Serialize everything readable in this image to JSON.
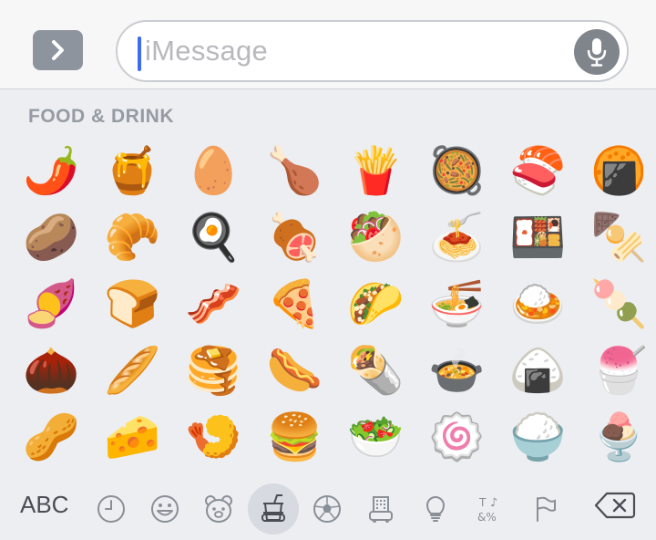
{
  "input": {
    "placeholder": "iMessage"
  },
  "keyboard": {
    "section_title": "FOOD & DRINK",
    "abc_label": "ABC",
    "emojis": [
      "🌶️",
      "🍯",
      "🥚",
      "🍗",
      "🍟",
      "🥘",
      "🍣",
      "🍘",
      "🥔",
      "🥐",
      "🍳",
      "🍖",
      "🥙",
      "🍝",
      "🍱",
      "🍢",
      "🍠",
      "🍞",
      "🥓",
      "🍕",
      "🌮",
      "🍜",
      "🍛",
      "🍡",
      "🌰",
      "🥖",
      "🥞",
      "🌭",
      "🌯",
      "🍲",
      "🍙",
      "🍧",
      "🥜",
      "🧀",
      "🍤",
      "🍔",
      "🥗",
      "🍥",
      "🍚",
      "🍨"
    ],
    "categories": [
      "clock-icon",
      "smiley-icon",
      "bear-icon",
      "food-drink-icon",
      "soccer-ball-icon",
      "building-icon",
      "lightbulb-icon",
      "symbols-icon",
      "flag-icon"
    ],
    "active_category": "food-drink-icon"
  }
}
